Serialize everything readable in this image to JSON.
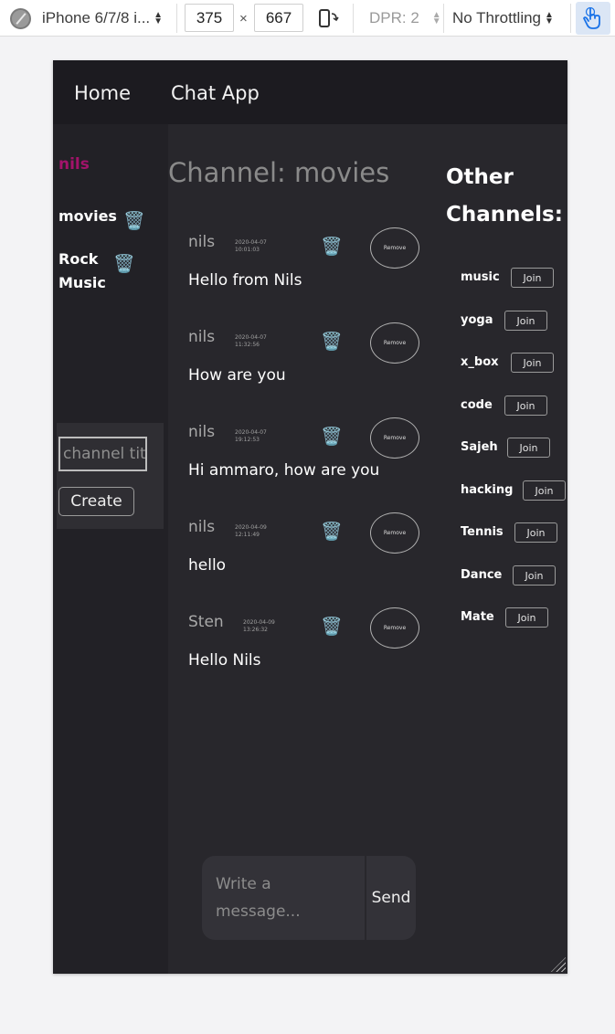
{
  "devtools": {
    "device": "iPhone 6/7/8 i...",
    "width": "375",
    "times": "×",
    "height": "667",
    "dpr": "DPR: 2",
    "throttling": "No Throttling"
  },
  "nav": {
    "home": "Home",
    "chat_app": "Chat App"
  },
  "sidebar": {
    "username": "nils",
    "channels": [
      {
        "label": "movies"
      },
      {
        "label_line1": "Rock",
        "label_line2": "Music"
      }
    ],
    "channel_input_placeholder": "channel tit",
    "create_label": "Create"
  },
  "channel": {
    "title": "Channel: movies",
    "remove_label": "Remove",
    "messages": [
      {
        "author": "nils",
        "date": "2020-04-07",
        "time": "10:01:03",
        "text": "Hello from Nils"
      },
      {
        "author": "nils",
        "date": "2020-04-07",
        "time": "11:32:56",
        "text": "How are you"
      },
      {
        "author": "nils",
        "date": "2020-04-07",
        "time": "19:12:53",
        "text": "Hi ammaro, how are you"
      },
      {
        "author": "nils",
        "date": "2020-04-09",
        "time": "12:11:49",
        "text": "hello"
      },
      {
        "author": "Sten",
        "date": "2020-04-09",
        "time": "13:26:32",
        "text": "Hello Nils"
      }
    ]
  },
  "other_channels": {
    "title_line1": "Other",
    "title_line2": "Channels:",
    "join_label": "Join",
    "items": [
      "music",
      "yoga",
      "x_box",
      "code",
      "Sajeh",
      "hacking",
      "Tennis",
      "Dance",
      "Mate"
    ]
  },
  "composer": {
    "placeholder_line1": "Write a",
    "placeholder_line2": "message...",
    "send_label": "Send"
  },
  "icons": {
    "trash": "trash-can-icon"
  }
}
